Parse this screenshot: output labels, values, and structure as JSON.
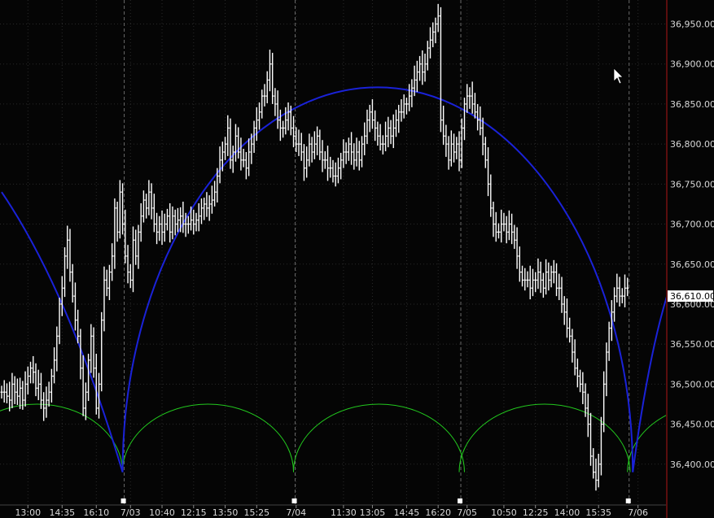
{
  "chart_data": {
    "type": "line",
    "title": "",
    "xlabel": "",
    "ylabel": "",
    "ylim": [
      36350,
      36980
    ],
    "grid": true,
    "y_ticks": [
      36400,
      36450,
      36500,
      36550,
      36600,
      36650,
      36700,
      36750,
      36800,
      36850,
      36900,
      36950
    ],
    "y_tick_labels": [
      "36,400.00",
      "36,450.00",
      "36,500.00",
      "36,550.00",
      "36,600.00",
      "36,650.00",
      "36,700.00",
      "36,750.00",
      "36,800.00",
      "36,850.00",
      "36,900.00",
      "36,950.00"
    ],
    "x_ticks": [
      {
        "label": "13:00",
        "bar": 10
      },
      {
        "label": "14:35",
        "bar": 23
      },
      {
        "label": "16:10",
        "bar": 36
      },
      {
        "label": "7/03",
        "bar": 49
      },
      {
        "label": "10:40",
        "bar": 61
      },
      {
        "label": "12:15",
        "bar": 73
      },
      {
        "label": "13:50",
        "bar": 85
      },
      {
        "label": "15:25",
        "bar": 97
      },
      {
        "label": "7/04",
        "bar": 112
      },
      {
        "label": "11:30",
        "bar": 130
      },
      {
        "label": "13:05",
        "bar": 141
      },
      {
        "label": "14:45",
        "bar": 154
      },
      {
        "label": "16:20",
        "bar": 166
      },
      {
        "label": "7/05",
        "bar": 177
      },
      {
        "label": "10:50",
        "bar": 191
      },
      {
        "label": "12:25",
        "bar": 203
      },
      {
        "label": "14:00",
        "bar": 215
      },
      {
        "label": "15:35",
        "bar": 227
      },
      {
        "label": "7/06",
        "bar": 242
      }
    ],
    "session_separators": [
      46,
      111,
      174,
      238
    ],
    "current_price": {
      "value": 36610,
      "label": "36,610.00"
    },
    "series": [
      {
        "values": [
          36490,
          36490,
          36485,
          36480,
          36500,
          36490,
          36485,
          36495,
          36480,
          36500,
          36510,
          36520,
          36515,
          36495,
          36500,
          36480,
          36470,
          36480,
          36490,
          36510,
          36530,
          36560,
          36600,
          36620,
          36660,
          36680,
          36640,
          36610,
          36580,
          36560,
          36520,
          36470,
          36490,
          36530,
          36560,
          36520,
          36470,
          36500,
          36580,
          36630,
          36620,
          36640,
          36660,
          36720,
          36690,
          36740,
          36700,
          36660,
          36640,
          36630,
          36680,
          36660,
          36690,
          36710,
          36730,
          36720,
          36740,
          36720,
          36700,
          36690,
          36700,
          36690,
          36700,
          36710,
          36690,
          36710,
          36700,
          36705,
          36710,
          36700,
          36700,
          36700,
          36705,
          36700,
          36705,
          36710,
          36720,
          36725,
          36720,
          36725,
          36730,
          36740,
          36760,
          36780,
          36790,
          36800,
          36820,
          36780,
          36790,
          36810,
          36790,
          36780,
          36780,
          36770,
          36790,
          36800,
          36820,
          36830,
          36840,
          36860,
          36860,
          36880,
          36900,
          36860,
          36850,
          36830,
          36820,
          36820,
          36830,
          36840,
          36820,
          36810,
          36800,
          36800,
          36790,
          36770,
          36780,
          36800,
          36790,
          36800,
          36810,
          36790,
          36780,
          36780,
          36770,
          36770,
          36760,
          36760,
          36770,
          36780,
          36790,
          36790,
          36800,
          36790,
          36780,
          36790,
          36780,
          36800,
          36810,
          36830,
          36840,
          36830,
          36820,
          36810,
          36800,
          36800,
          36810,
          36820,
          36810,
          36820,
          36830,
          36840,
          36840,
          36850,
          36850,
          36860,
          36870,
          36880,
          36890,
          36900,
          36890,
          36900,
          36920,
          36930,
          36940,
          36950,
          36960,
          36830,
          36810,
          36800,
          36780,
          36800,
          36790,
          36800,
          36780,
          36820,
          36850,
          36860,
          36860,
          36850,
          36840,
          36830,
          36820,
          36800,
          36780,
          36750,
          36720,
          36700,
          36690,
          36690,
          36700,
          36700,
          36690,
          36700,
          36690,
          36680,
          36660,
          36640,
          36630,
          36630,
          36630,
          36620,
          36630,
          36630,
          36640,
          36630,
          36620,
          36640,
          36630,
          36640,
          36640,
          36620,
          36620,
          36600,
          36590,
          36570,
          36560,
          36540,
          36520,
          36510,
          36500,
          36490,
          36470,
          36450,
          36410,
          36390,
          36380,
          36400,
          36450,
          36500,
          36540,
          36570,
          36590,
          36610,
          36620,
          36610,
          36610,
          36620,
          36620
        ]
      }
    ],
    "arcs": {
      "blue_big": {
        "start_bar": 46,
        "end_bar": 240,
        "base": 36390,
        "peak": 36871,
        "color": "#1a22d8"
      },
      "blue_left_tail": {
        "from_bar": 0,
        "to_bar": 46,
        "start_value": 36740,
        "color": "#1a22d8"
      },
      "blue_right_tail": {
        "from_bar": 240,
        "to_bar": 253,
        "end_value": 36610,
        "color": "#1a22d8"
      },
      "green_small": {
        "starts": [
          46,
          111,
          174,
          238
        ],
        "width_bars": 65,
        "base": 36390,
        "peak": 36475,
        "color": "#22c81e"
      },
      "green_left_partial": {
        "from_bar": -19,
        "to_bar": 46
      },
      "green_right_partial": {
        "from_bar": 238,
        "to_bar": 303
      }
    },
    "colors": {
      "background": "#050505",
      "grid": "#2a2a2a",
      "separator": "#6a6a6a",
      "price": "#ffffff",
      "axis": "#b01818",
      "marker": "#ffffff"
    }
  }
}
